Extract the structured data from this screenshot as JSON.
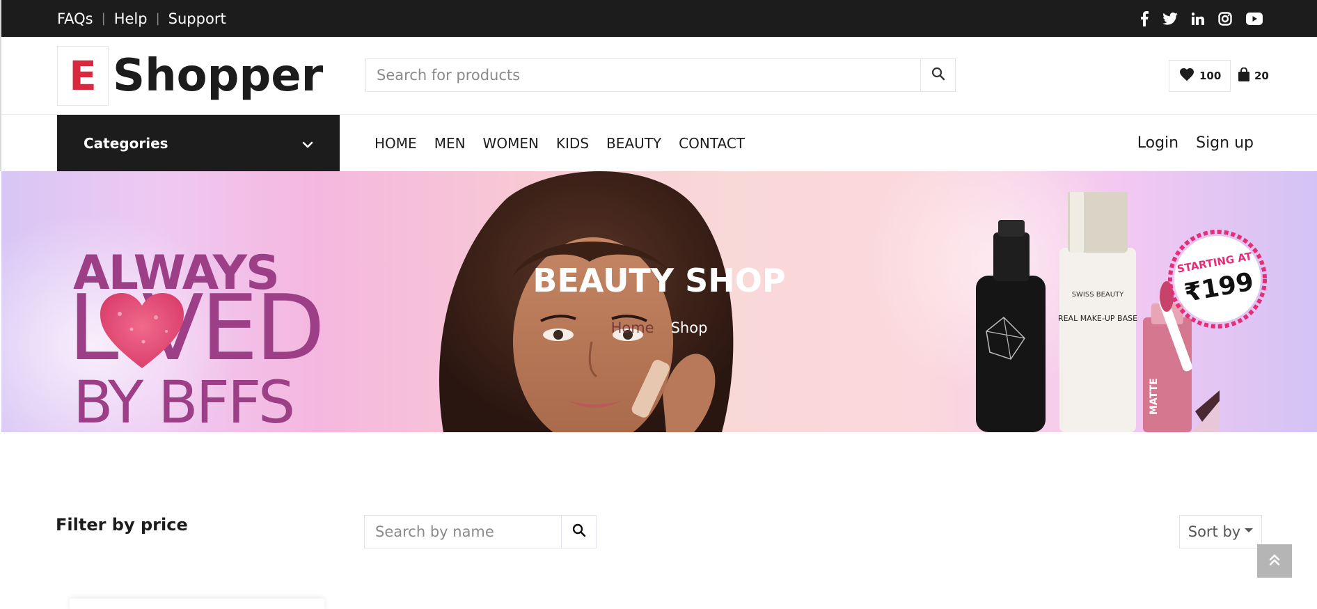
{
  "topbar": {
    "links": [
      "FAQs",
      "Help",
      "Support"
    ],
    "social_icons": [
      "facebook-icon",
      "twitter-icon",
      "linkedin-icon",
      "instagram-icon",
      "youtube-icon"
    ]
  },
  "header": {
    "logo_letter": "E",
    "logo_name": "Shopper",
    "search_placeholder": "Search for products",
    "wishlist_count": "100",
    "cart_count": "20"
  },
  "nav": {
    "categories_label": "Categories",
    "items": [
      "HOME",
      "MEN",
      "WOMEN",
      "KIDS",
      "BEAUTY",
      "CONTACT"
    ],
    "login": "Login",
    "signup": "Sign up"
  },
  "banner": {
    "title": "BEAUTY SHOP",
    "breadcrumb_home": "Home",
    "breadcrumb_current": "Shop",
    "promo_line1": "ALWAYS",
    "promo_line2": "L  VED",
    "promo_line3": "BY BFFS",
    "badge_top": "STARTING AT",
    "badge_price": "₹199",
    "product_label_1": "SWISS BEAUTY",
    "product_label_2": "REAL MAKE-UP BASE",
    "product_label_3": "MATTE"
  },
  "shop": {
    "filter_title": "Filter by price",
    "name_search_placeholder": "Search by name",
    "sort_label": "Sort by"
  },
  "colors": {
    "accent": "#d9293f",
    "dark": "#1c1c1c",
    "promo": "#9c3f86"
  }
}
